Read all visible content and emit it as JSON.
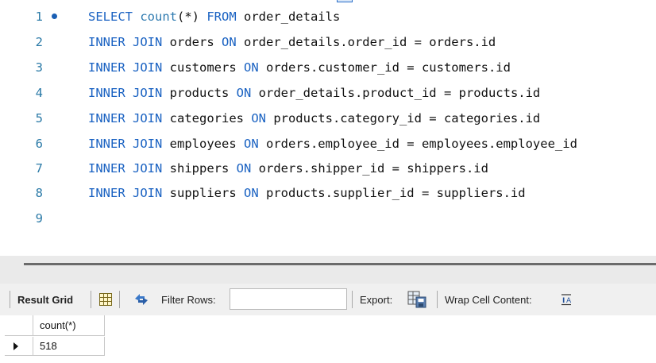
{
  "editor": {
    "lines": [
      {
        "number": "1",
        "active": true,
        "tokens": [
          {
            "kind": "kw",
            "text": "SELECT "
          },
          {
            "kind": "fn",
            "text": "count"
          },
          {
            "kind": "plain",
            "text": "(*) "
          },
          {
            "kind": "kw",
            "text": "FROM"
          },
          {
            "kind": "plain",
            "text": " order_details"
          }
        ]
      },
      {
        "number": "2",
        "tokens": [
          {
            "kind": "kw",
            "text": "INNER JOIN"
          },
          {
            "kind": "plain",
            "text": " orders "
          },
          {
            "kind": "kw",
            "text": "ON"
          },
          {
            "kind": "plain",
            "text": " order_details.order_id = orders.id"
          }
        ]
      },
      {
        "number": "3",
        "tokens": [
          {
            "kind": "kw",
            "text": "INNER JOIN"
          },
          {
            "kind": "plain",
            "text": " customers "
          },
          {
            "kind": "kw",
            "text": "ON"
          },
          {
            "kind": "plain",
            "text": " orders.customer_id = customers.id"
          }
        ]
      },
      {
        "number": "4",
        "tokens": [
          {
            "kind": "kw",
            "text": "INNER JOIN"
          },
          {
            "kind": "plain",
            "text": " products "
          },
          {
            "kind": "kw",
            "text": "ON"
          },
          {
            "kind": "plain",
            "text": " order_details.product_id = products.id"
          }
        ]
      },
      {
        "number": "5",
        "tokens": [
          {
            "kind": "kw",
            "text": "INNER JOIN"
          },
          {
            "kind": "plain",
            "text": " categories "
          },
          {
            "kind": "kw",
            "text": "ON"
          },
          {
            "kind": "plain",
            "text": " products.category_id = categories.id"
          }
        ]
      },
      {
        "number": "6",
        "tokens": [
          {
            "kind": "kw",
            "text": "INNER JOIN"
          },
          {
            "kind": "plain",
            "text": " employees "
          },
          {
            "kind": "kw",
            "text": "ON"
          },
          {
            "kind": "plain",
            "text": " orders.employee_id = employees.employee_id"
          }
        ]
      },
      {
        "number": "7",
        "tokens": [
          {
            "kind": "kw",
            "text": "INNER JOIN"
          },
          {
            "kind": "plain",
            "text": " shippers "
          },
          {
            "kind": "kw",
            "text": "ON"
          },
          {
            "kind": "plain",
            "text": " orders.shipper_id = shippers.id"
          }
        ]
      },
      {
        "number": "8",
        "tokens": [
          {
            "kind": "kw",
            "text": "INNER JOIN"
          },
          {
            "kind": "plain",
            "text": " suppliers "
          },
          {
            "kind": "kw",
            "text": "ON"
          },
          {
            "kind": "plain",
            "text": " products.supplier_id = suppliers.id"
          }
        ]
      },
      {
        "number": "9",
        "tokens": []
      }
    ]
  },
  "toolbar": {
    "result_grid_label": "Result Grid",
    "filter_rows_label": "Filter Rows:",
    "filter_value": "",
    "export_label": "Export:",
    "wrap_label": "Wrap Cell Content:",
    "icons": [
      "grid-icon",
      "refresh-arrows-icon",
      "export-icon",
      "wrap-text-icon"
    ]
  },
  "result": {
    "columns": [
      "count(*)"
    ],
    "rows": [
      [
        "518"
      ]
    ]
  },
  "colors": {
    "keyword": "#1a62c2",
    "function": "#2f7bb0",
    "line_number": "#2b7aa7"
  }
}
